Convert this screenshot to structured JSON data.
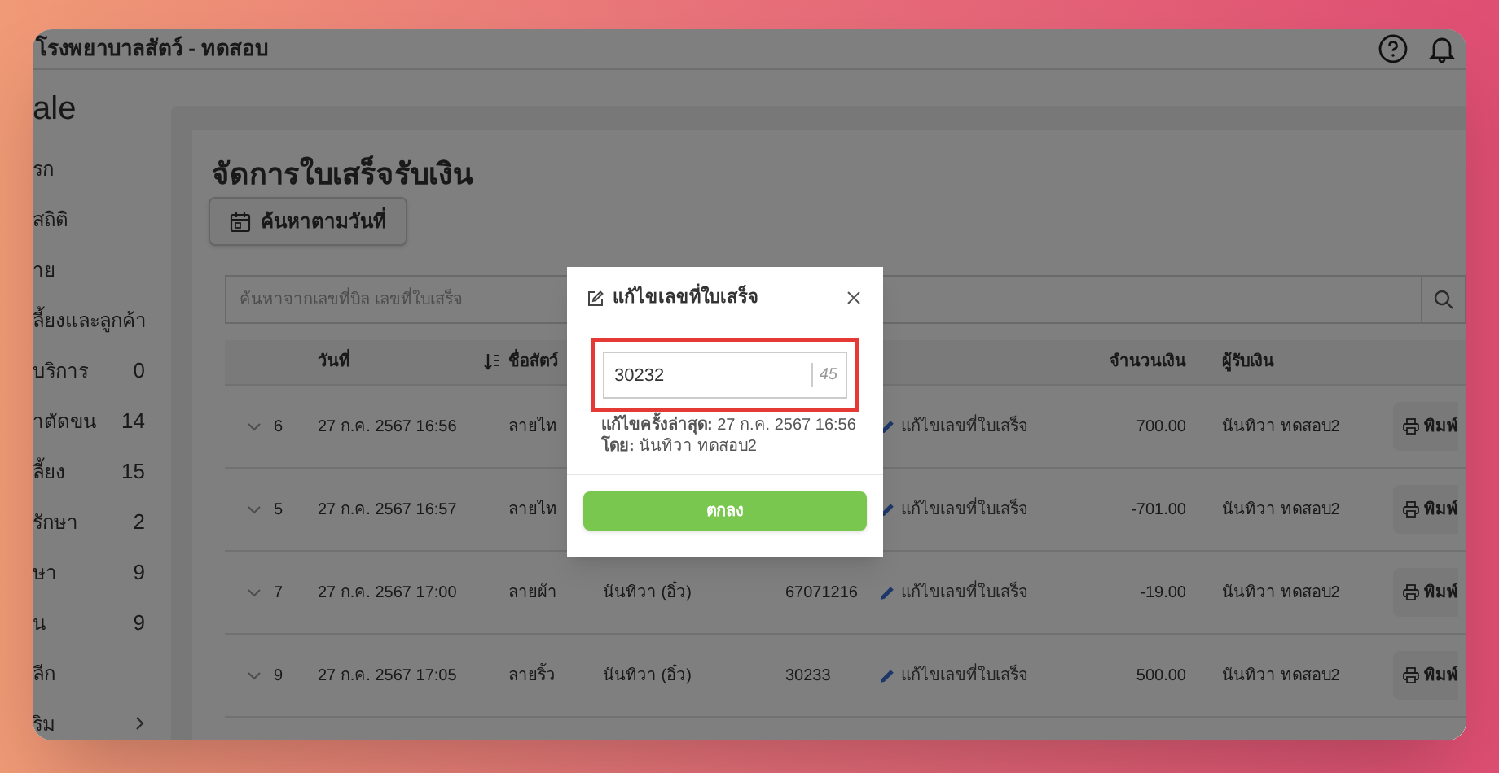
{
  "app_bar": {
    "title": "โรงพยาบาลสัตว์ - ทดสอบ"
  },
  "sidebar": {
    "logo": "ale",
    "items": [
      {
        "kind": "link",
        "label": "รก"
      },
      {
        "kind": "link",
        "label": "สถิติ"
      },
      {
        "kind": "link",
        "label": "าย"
      },
      {
        "kind": "link",
        "label": "ลี้ยงและลูกค้า"
      },
      {
        "kind": "count",
        "label": "บริการ",
        "count": "0"
      },
      {
        "kind": "count",
        "label": "าตัดขน",
        "count": "14"
      },
      {
        "kind": "count",
        "label": "ลี้ยง",
        "count": "15"
      },
      {
        "kind": "count",
        "label": "รักษา",
        "count": "2"
      },
      {
        "kind": "count",
        "label": "ษา",
        "count": "9"
      },
      {
        "kind": "count",
        "label": "น",
        "count": "9"
      },
      {
        "kind": "link",
        "label": "ลีก"
      },
      {
        "kind": "group",
        "label": "ริม"
      }
    ]
  },
  "page": {
    "heading": "จัดการใบเสร็จรับเงิน",
    "date_filter_button": "ค้นหาตามวันที่",
    "search": {
      "placeholder": "ค้นหาจากเลขที่บิล เลขที่ใบเสร็จ"
    },
    "table": {
      "columns": [
        {
          "label": "วันที่",
          "sorted": true
        },
        {
          "label": "ชื่อสัตว์",
          "sorted": false
        },
        {
          "label": "จำนวนเงิน",
          "sorted": false
        },
        {
          "label": "ผู้รับเงิน",
          "sorted": false
        }
      ],
      "rows": [
        {
          "no": "6",
          "date": "27 ก.ค. 2567 16:56",
          "pet": "ลายไท",
          "edit_link": "แก้ไขเลขที่ใบเสร็จ",
          "amount": "700.00",
          "receiver": "นันทิวา ทดสอบ2",
          "print_button": "พิมพ์"
        },
        {
          "no": "5",
          "date": "27 ก.ค. 2567 16:57",
          "pet": "ลายไท",
          "edit_link": "แก้ไขเลขที่ใบเสร็จ",
          "amount": "-701.00",
          "receiver": "นันทิวา ทดสอบ2",
          "print_button": "พิมพ์"
        },
        {
          "no": "7",
          "date": "27 ก.ค. 2567 17:00",
          "pet": "ลายผ้า",
          "owner": "นันทิวา (อิ๋ว)",
          "receipt_no": "67071216",
          "edit_link": "แก้ไขเลขที่ใบเสร็จ",
          "amount": "-19.00",
          "receiver": "นันทิวา ทดสอบ2",
          "print_button": "พิมพ์"
        },
        {
          "no": "9",
          "date": "27 ก.ค. 2567 17:05",
          "pet": "ลายริ้ว",
          "owner": "นันทิวา (อิ๋ว)",
          "receipt_no": "30233",
          "edit_link": "แก้ไขเลขที่ใบเสร็จ",
          "amount": "500.00",
          "receiver": "นันทิวา ทดสอบ2",
          "print_button": "พิมพ์"
        }
      ]
    }
  },
  "dialog": {
    "title": "แก้ไขเลขที่ใบเสร็จ",
    "receipt_field": {
      "value": "30232",
      "counter": "45"
    },
    "meta": [
      "**แก้ไขครั้งล่าสุด:** 27 ก.ค. 2567 16:56",
      "**โดย:** นันทิวา ทดสอบ2"
    ],
    "confirm_button": "ตกลง"
  }
}
